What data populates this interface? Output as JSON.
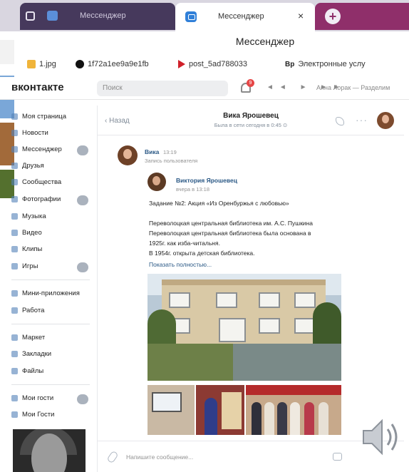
{
  "browser": {
    "tabs": [
      {
        "label": "Мессенджер",
        "active": false
      },
      {
        "label": "Мессенджер",
        "active": true,
        "close_glyph": "×"
      }
    ],
    "new_tab_glyph": "+",
    "window_title": "Мессенджер",
    "bookmarks": [
      {
        "label": "1.jpg",
        "icon": "image-file-icon"
      },
      {
        "label": "1f72a1ee9a9e1fb",
        "icon": "pinterest-icon"
      },
      {
        "label": "post_5ad788033",
        "icon": "red-arrow-icon"
      },
      {
        "label": "Электронные услу",
        "icon": "services-icon",
        "icon_glyph": "Bp"
      }
    ]
  },
  "vk": {
    "logo": "вконтакте",
    "search_placeholder": "Поиск",
    "notifications_count": "9",
    "player_glyphs": "◄◄ ► ►►",
    "user_label": "Анна Лорак — Разделим"
  },
  "sidebar": {
    "items": [
      {
        "label": "Моя страница"
      },
      {
        "label": "Новости"
      },
      {
        "label": "Мессенджер",
        "has_counter": true
      },
      {
        "label": "Друзья"
      },
      {
        "label": "Сообщества"
      },
      {
        "label": "Фотографии",
        "has_counter": true
      },
      {
        "label": "Музыка"
      },
      {
        "label": "Видео"
      },
      {
        "label": "Клипы"
      },
      {
        "label": "Игры",
        "has_counter": true
      },
      {
        "label": "Мини-приложения"
      },
      {
        "label": "Работа"
      },
      {
        "label": "Маркет"
      },
      {
        "label": "Закладки"
      },
      {
        "label": "Файлы"
      },
      {
        "label": "Мои гости",
        "has_counter": true
      },
      {
        "label": "Мои Гости"
      }
    ]
  },
  "chat": {
    "back_label": "‹ Назад",
    "peer_name": "Вика Ярошевец",
    "peer_status": "Была в сети сегодня в 0:45 ⊙",
    "more_glyph": "···",
    "message": {
      "author": "Вика",
      "time": "13:19",
      "subtitle": "Запись пользователя"
    },
    "repost": {
      "author": "Виктория Ярошевец",
      "time": "вчера в 13:18",
      "lines": [
        "Задание №2: Акция «Из Оренбуржья с любовью»",
        "",
        "Переволоцкая центральная библиотека им. А.С. Пушкина",
        "Переволоцкая центральная библиотека была основана в",
        "1925г. как изба-читальня.",
        "В 1954г. открыта детская библиотека."
      ],
      "show_more": "Показать полностью..."
    },
    "composer_placeholder": "Напишите сообщение..."
  },
  "colors": {
    "tab_dark": "#46395c",
    "tab_new": "#8f2f6a",
    "vk_link": "#2a5885",
    "muted": "#818c99"
  }
}
